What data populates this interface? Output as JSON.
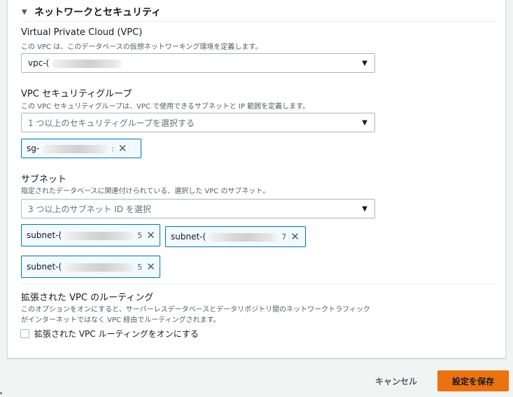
{
  "section": {
    "title": "ネットワークとセキュリティ"
  },
  "vpc": {
    "label": "Virtual Private Cloud (VPC)",
    "description": "この VPC は、このデータベースの仮想ネットワーキング環境を定義します。",
    "value": "vpc-("
  },
  "security_groups": {
    "label": "VPC セキュリティグループ",
    "description": "この VPC セキュリティグループは、VPC で使用できるサブネットと IP 範囲を定義します。",
    "placeholder": "1 つ以上のセキュリティグループを選択する",
    "tokens": [
      {
        "prefix": "sg-",
        "suffix": ":"
      }
    ]
  },
  "subnets": {
    "label": "サブネット",
    "description": "指定されたデータベースに関連付けられている、選択した VPC のサブネット。",
    "placeholder": "3 つ以上のサブネット ID を選択",
    "tokens": [
      {
        "prefix": "subnet-(",
        "suffix": "5"
      },
      {
        "prefix": "subnet-(",
        "suffix": "7"
      },
      {
        "prefix": "subnet-(",
        "suffix": "5"
      }
    ]
  },
  "routing": {
    "label": "拡張された VPC のルーティング",
    "description_line1": "このオプションをオンにすると、サーバーレスデータベースとデータリポジトリ間のネットワークトラフィック",
    "description_line2": "がインターネットではなく VPC 経由でルーティングされます。",
    "checkbox_label": "拡張された VPC ルーティングをオンにする",
    "checked": false
  },
  "footer": {
    "cancel_label": "キャンセル",
    "save_label": "設定を保存"
  },
  "icons": {
    "caret": "caret-down-icon",
    "dropdown_arrow": "triangle-down-icon",
    "dismiss": "close-icon"
  },
  "colors": {
    "primary_button": "#ec7211",
    "token_border": "#0073bb",
    "token_background": "#f1faff"
  }
}
